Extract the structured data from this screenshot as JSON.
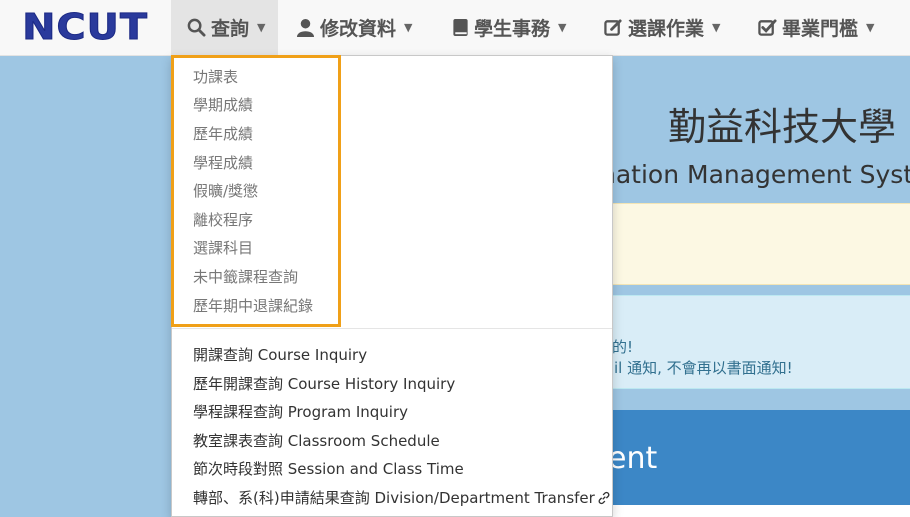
{
  "navbar": {
    "logo": "NCUT",
    "items": [
      {
        "label": "查詢",
        "icon": "search-icon"
      },
      {
        "label": "修改資料",
        "icon": "user-icon"
      },
      {
        "label": "學生事務",
        "icon": "book-icon"
      },
      {
        "label": "選課作業",
        "icon": "edit-icon"
      },
      {
        "label": "畢業門檻",
        "icon": "check-square-icon"
      }
    ]
  },
  "background": {
    "title_cn": "勤益科技大學",
    "title_en": "nation Management Syste",
    "info_line1": "的!",
    "info_line2": "il 通知, 不會再以書面通知!",
    "banner_text": "ent"
  },
  "dropdown": {
    "highlight_color": "#f0a018",
    "top_items": [
      "功課表",
      "學期成績",
      "歷年成績",
      "學程成績",
      "假曠/獎懲",
      "離校程序",
      "選課科目",
      "未中籤課程查詢",
      "歷年期中退課紀錄"
    ],
    "bottom_items": [
      "開課查詢 Course Inquiry",
      "歷年開課查詢 Course History Inquiry",
      "學程課程查詢 Program Inquiry",
      "教室課表查詢 Classroom Schedule",
      "節次時段對照 Session and Class Time",
      "轉部、系(科)申請結果查詢 Division/Department Transfer"
    ]
  }
}
